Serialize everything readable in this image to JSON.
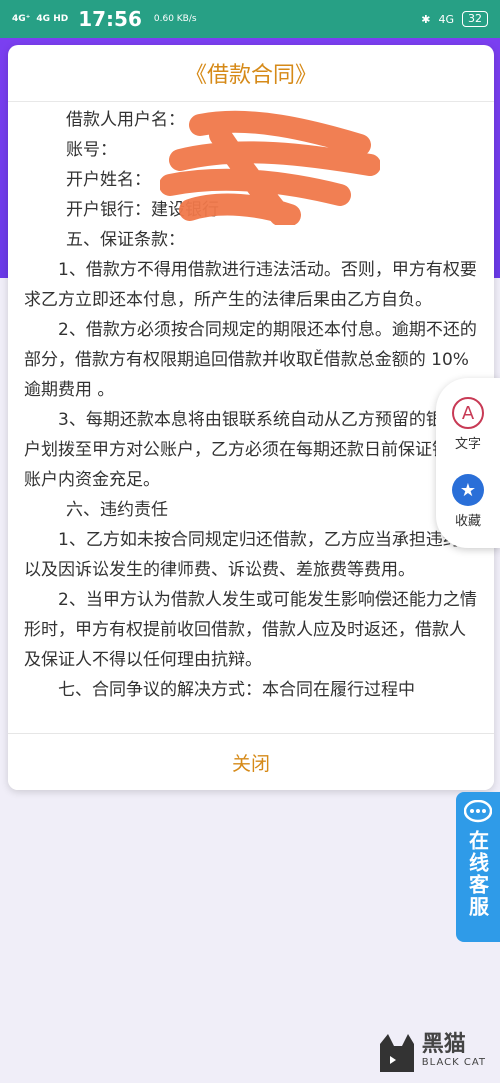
{
  "statusbar": {
    "net1": "4G⁺",
    "net2": "4G HD",
    "time": "17:56",
    "speed": "0.60 KB/s",
    "bt": "✱",
    "net3": "4G",
    "battery": "32"
  },
  "modal": {
    "title": "《借款合同》",
    "lines": [
      "借款人用户名：",
      "账号：",
      "开户姓名：",
      "开户银行：建设银行",
      "五、保证条款：",
      "1、借款方不得用借款进行违法活动。否则，甲方有权要求乙方立即还本付息，所产生的法律后果由乙方自负。",
      "2、借款方必须按合同规定的期限还本付息。逾期不还的部分，借款方有权限期追回借款并收取Ě借款总金额的 10% 逾期费用 。",
      "3、每期还款本息将由银联系统自动从乙方预留的银行账户划拨至甲方对公账户，乙方必须在每期还款日前保证银行账户内资金充足。",
      "六、违约责任",
      "1、乙方如未按合同规定归还借款，乙方应当承担违约金以及因诉讼发生的律师费、诉讼费、差旅费等费用。",
      "2、当甲方认为借款人发生或可能发生影响偿还能力之情形时，甲方有权提前收回借款，借款人应及时返还，借款人及保证人不得以任何理由抗辩。",
      "七、合同争议的解决方式：本合同在履行过程中"
    ],
    "close_label": "关闭"
  },
  "sidepanel": {
    "text_label": "文字",
    "text_icon": "A",
    "fav_label": "收藏",
    "fav_icon": "★"
  },
  "service": {
    "label": "在线客服"
  },
  "watermark": {
    "cn": "黑猫",
    "en": "BLACK CAT"
  },
  "colors": {
    "statusbar": "#27a085",
    "accent": "#d68a18",
    "purple": "#7b3ff0",
    "service": "#2f9be8"
  }
}
